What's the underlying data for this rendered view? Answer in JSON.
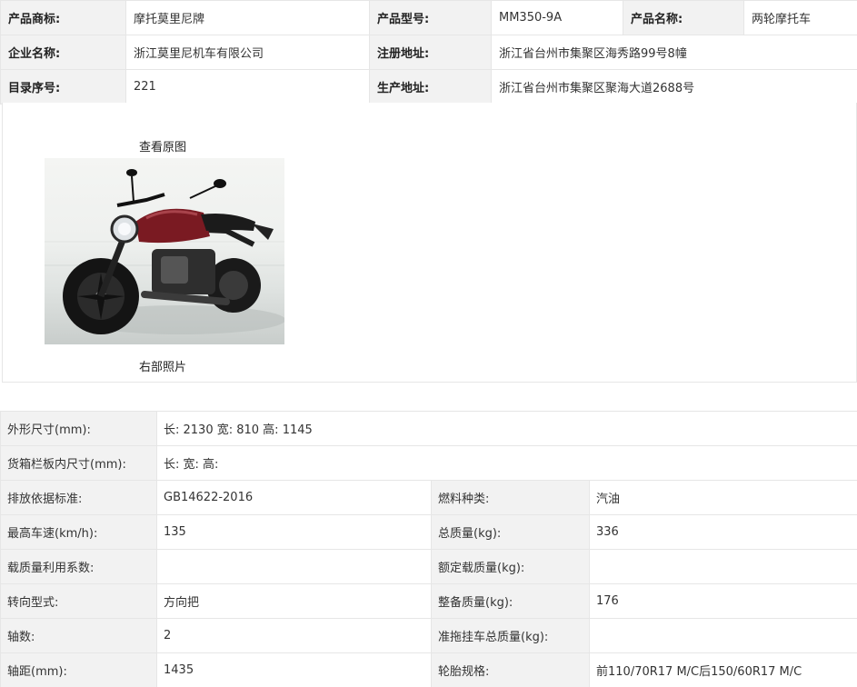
{
  "basic": {
    "row1": [
      {
        "label": "产品商标:",
        "value": "摩托莫里尼牌"
      },
      {
        "label": "产品型号:",
        "value": "MM350-9A"
      },
      {
        "label": "产品名称:",
        "value": "两轮摩托车"
      }
    ],
    "row2": [
      {
        "label": "企业名称:",
        "value": "浙江莫里尼机车有限公司"
      },
      {
        "label": "注册地址:",
        "value": "浙江省台州市集聚区海秀路99号8幢"
      }
    ],
    "row3": [
      {
        "label": "目录序号:",
        "value": "221"
      },
      {
        "label": "生产地址:",
        "value": "浙江省台州市集聚区聚海大道2688号"
      }
    ]
  },
  "photo": {
    "title": "查看原图",
    "caption": "右部照片",
    "colors": {
      "tank": "#7a1a22",
      "frame": "#1e1e1e",
      "wall": "#f2f3f1",
      "floor": "#c9cecc"
    }
  },
  "specs": {
    "dimensions": {
      "label": "外形尺寸(mm):",
      "value": "长: 2130 宽: 810 高: 1145"
    },
    "cargo_box": {
      "label": "货箱栏板内尺寸(mm):",
      "value": "长:   宽:   高:"
    },
    "rows": [
      {
        "l1": "排放依据标准:",
        "v1": "GB14622-2016",
        "l2": "燃料种类:",
        "v2": "汽油"
      },
      {
        "l1": "最高车速(km/h):",
        "v1": "135",
        "l2": "总质量(kg):",
        "v2": "336"
      },
      {
        "l1": "载质量利用系数:",
        "v1": "",
        "l2": "额定载质量(kg):",
        "v2": ""
      },
      {
        "l1": "转向型式:",
        "v1": "方向把",
        "l2": "整备质量(kg):",
        "v2": "176"
      },
      {
        "l1": "轴数:",
        "v1": "2",
        "l2": "准拖挂车总质量(kg):",
        "v2": ""
      },
      {
        "l1": "轴距(mm):",
        "v1": "1435",
        "l2": "轮胎规格:",
        "v2": "前110/70R17 M/C后150/60R17 M/C"
      }
    ]
  }
}
